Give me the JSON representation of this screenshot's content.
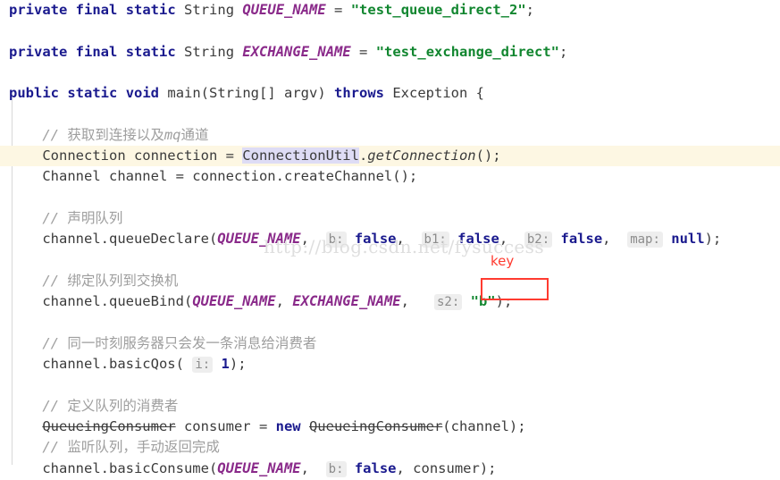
{
  "editor": {
    "language": "java",
    "colors": {
      "keyword": "#1a1a8e",
      "constant": "#8a2a8a",
      "string": "#11862f",
      "comment": "#9e9e9e",
      "number": "#1a1a8e",
      "plain": "#3b3b3b",
      "current_line_bg": "#fdf7e3",
      "usage_highlight_bg": "#dedcf5",
      "param_hint_bg": "#eeeeee",
      "annotation_red": "#ff3b30",
      "watermark": "#dedede",
      "background": "#ffffff"
    },
    "lines": [
      {
        "id": "line-queue-name-decl",
        "highlighted": false,
        "tokens": [
          {
            "t": "private",
            "c": "kw"
          },
          {
            "t": " ",
            "c": "plain"
          },
          {
            "t": "final",
            "c": "kw"
          },
          {
            "t": " ",
            "c": "plain"
          },
          {
            "t": "static",
            "c": "kw"
          },
          {
            "t": " ",
            "c": "plain"
          },
          {
            "t": "String",
            "c": "type"
          },
          {
            "t": " ",
            "c": "plain"
          },
          {
            "t": "QUEUE_NAME",
            "c": "const"
          },
          {
            "t": " = ",
            "c": "plain"
          },
          {
            "t": "\"test_queue_direct_2\"",
            "c": "str"
          },
          {
            "t": ";",
            "c": "plain"
          }
        ]
      },
      {
        "id": "line-blank-1",
        "blank": true,
        "tokens": []
      },
      {
        "id": "line-exchange-name-decl",
        "highlighted": false,
        "tokens": [
          {
            "t": "private",
            "c": "kw"
          },
          {
            "t": " ",
            "c": "plain"
          },
          {
            "t": "final",
            "c": "kw"
          },
          {
            "t": " ",
            "c": "plain"
          },
          {
            "t": "static",
            "c": "kw"
          },
          {
            "t": " ",
            "c": "plain"
          },
          {
            "t": "String",
            "c": "type"
          },
          {
            "t": " ",
            "c": "plain"
          },
          {
            "t": "EXCHANGE_NAME",
            "c": "const"
          },
          {
            "t": " = ",
            "c": "plain"
          },
          {
            "t": "\"test_exchange_direct\"",
            "c": "str"
          },
          {
            "t": ";",
            "c": "plain"
          }
        ]
      },
      {
        "id": "line-blank-2",
        "blank": true,
        "tokens": []
      },
      {
        "id": "line-main-signature",
        "highlighted": false,
        "tokens": [
          {
            "t": "public",
            "c": "kw"
          },
          {
            "t": " ",
            "c": "plain"
          },
          {
            "t": "static",
            "c": "kw"
          },
          {
            "t": " ",
            "c": "plain"
          },
          {
            "t": "void",
            "c": "kw"
          },
          {
            "t": " ",
            "c": "plain"
          },
          {
            "t": "main(String[] argv) ",
            "c": "plain"
          },
          {
            "t": "throws",
            "c": "kw"
          },
          {
            "t": " Exception {",
            "c": "plain"
          }
        ]
      },
      {
        "id": "line-blank-3",
        "blank": true,
        "tokens": []
      },
      {
        "id": "line-comment-connection",
        "highlighted": false,
        "tokens": [
          {
            "t": "    // ",
            "c": "cmt"
          },
          {
            "t": "获取到连接以及",
            "c": "cmt-cjk"
          },
          {
            "t": "mq",
            "c": "cmt-i"
          },
          {
            "t": "通道",
            "c": "cmt-cjk"
          }
        ]
      },
      {
        "id": "line-get-connection",
        "highlighted": true,
        "tokens": [
          {
            "t": "    Connection connection = ",
            "c": "plain"
          },
          {
            "t": "ConnectionUtil",
            "c": "usage-hl"
          },
          {
            "t": ".",
            "c": "plain"
          },
          {
            "t": "getConnection",
            "c": "mth-i"
          },
          {
            "t": "();",
            "c": "plain"
          }
        ]
      },
      {
        "id": "line-create-channel",
        "highlighted": false,
        "tokens": [
          {
            "t": "    Channel channel = connection.createChannel();",
            "c": "plain"
          }
        ]
      },
      {
        "id": "line-blank-4",
        "blank": true,
        "tokens": []
      },
      {
        "id": "line-comment-declare-queue",
        "highlighted": false,
        "tokens": [
          {
            "t": "    // ",
            "c": "cmt"
          },
          {
            "t": "声明队列",
            "c": "cmt-cjk"
          }
        ]
      },
      {
        "id": "line-queue-declare",
        "highlighted": false,
        "tokens": [
          {
            "t": "    channel.queueDeclare(",
            "c": "plain"
          },
          {
            "t": "QUEUE_NAME",
            "c": "const"
          },
          {
            "t": ", ",
            "c": "plain"
          },
          {
            "t": " ",
            "c": "plain"
          },
          {
            "t": "b:",
            "c": "hint"
          },
          {
            "t": " ",
            "c": "plain"
          },
          {
            "t": "false",
            "c": "kw"
          },
          {
            "t": ", ",
            "c": "plain"
          },
          {
            "t": " ",
            "c": "plain"
          },
          {
            "t": "b1:",
            "c": "hint"
          },
          {
            "t": " ",
            "c": "plain"
          },
          {
            "t": "false",
            "c": "kw"
          },
          {
            "t": ", ",
            "c": "plain"
          },
          {
            "t": " ",
            "c": "plain"
          },
          {
            "t": "b2:",
            "c": "hint"
          },
          {
            "t": " ",
            "c": "plain"
          },
          {
            "t": "false",
            "c": "kw"
          },
          {
            "t": ", ",
            "c": "plain"
          },
          {
            "t": " ",
            "c": "plain"
          },
          {
            "t": "map:",
            "c": "hint"
          },
          {
            "t": " ",
            "c": "plain"
          },
          {
            "t": "null",
            "c": "kw"
          },
          {
            "t": ");",
            "c": "plain"
          }
        ]
      },
      {
        "id": "line-blank-5",
        "blank": true,
        "tokens": []
      },
      {
        "id": "line-comment-bind-queue",
        "highlighted": false,
        "tokens": [
          {
            "t": "    // ",
            "c": "cmt"
          },
          {
            "t": "绑定队列到交换机",
            "c": "cmt-cjk"
          }
        ]
      },
      {
        "id": "line-queue-bind",
        "highlighted": false,
        "tokens": [
          {
            "t": "    channel.queueBind(",
            "c": "plain"
          },
          {
            "t": "QUEUE_NAME",
            "c": "const"
          },
          {
            "t": ", ",
            "c": "plain"
          },
          {
            "t": "EXCHANGE_NAME",
            "c": "const"
          },
          {
            "t": ", ",
            "c": "plain"
          },
          {
            "t": "  ",
            "c": "plain"
          },
          {
            "t": "s2:",
            "c": "hint"
          },
          {
            "t": " ",
            "c": "plain"
          },
          {
            "t": "\"b\"",
            "c": "str"
          },
          {
            "t": ");",
            "c": "plain"
          }
        ]
      },
      {
        "id": "line-blank-6",
        "blank": true,
        "tokens": []
      },
      {
        "id": "line-comment-qos",
        "highlighted": false,
        "tokens": [
          {
            "t": "    // ",
            "c": "cmt"
          },
          {
            "t": "同一时刻服务器只会发一条消息给消费者",
            "c": "cmt-cjk"
          }
        ]
      },
      {
        "id": "line-basic-qos",
        "highlighted": false,
        "tokens": [
          {
            "t": "    channel.basicQos( ",
            "c": "plain"
          },
          {
            "t": "i:",
            "c": "hint"
          },
          {
            "t": " ",
            "c": "plain"
          },
          {
            "t": "1",
            "c": "num"
          },
          {
            "t": ");",
            "c": "plain"
          }
        ]
      },
      {
        "id": "line-blank-7",
        "blank": true,
        "tokens": []
      },
      {
        "id": "line-comment-define-consumer",
        "highlighted": false,
        "tokens": [
          {
            "t": "    // ",
            "c": "cmt"
          },
          {
            "t": "定义队列的消费者",
            "c": "cmt-cjk"
          }
        ]
      },
      {
        "id": "line-new-consumer",
        "highlighted": false,
        "tokens": [
          {
            "t": "    ",
            "c": "plain"
          },
          {
            "t": "QueueingConsumer",
            "c": "deprecated"
          },
          {
            "t": " consumer = ",
            "c": "plain"
          },
          {
            "t": "new",
            "c": "kw"
          },
          {
            "t": " ",
            "c": "plain"
          },
          {
            "t": "QueueingConsumer",
            "c": "deprecated"
          },
          {
            "t": "(channel);",
            "c": "plain"
          }
        ]
      },
      {
        "id": "line-comment-listen-queue",
        "highlighted": false,
        "tokens": [
          {
            "t": "    // ",
            "c": "cmt"
          },
          {
            "t": "监听队列，手动返回完成",
            "c": "cmt-cjk"
          }
        ]
      },
      {
        "id": "line-basic-consume",
        "highlighted": false,
        "tokens": [
          {
            "t": "    channel.basicConsume(",
            "c": "plain"
          },
          {
            "t": "QUEUE_NAME",
            "c": "const"
          },
          {
            "t": ", ",
            "c": "plain"
          },
          {
            "t": " ",
            "c": "plain"
          },
          {
            "t": "b:",
            "c": "hint"
          },
          {
            "t": " ",
            "c": "plain"
          },
          {
            "t": "false",
            "c": "kw"
          },
          {
            "t": ", consumer);",
            "c": "plain"
          }
        ]
      }
    ]
  },
  "watermark": {
    "text": "http://blog.csdn.net/fysuccess"
  },
  "annotation": {
    "label": "key",
    "target": "s2: \"b\")"
  }
}
